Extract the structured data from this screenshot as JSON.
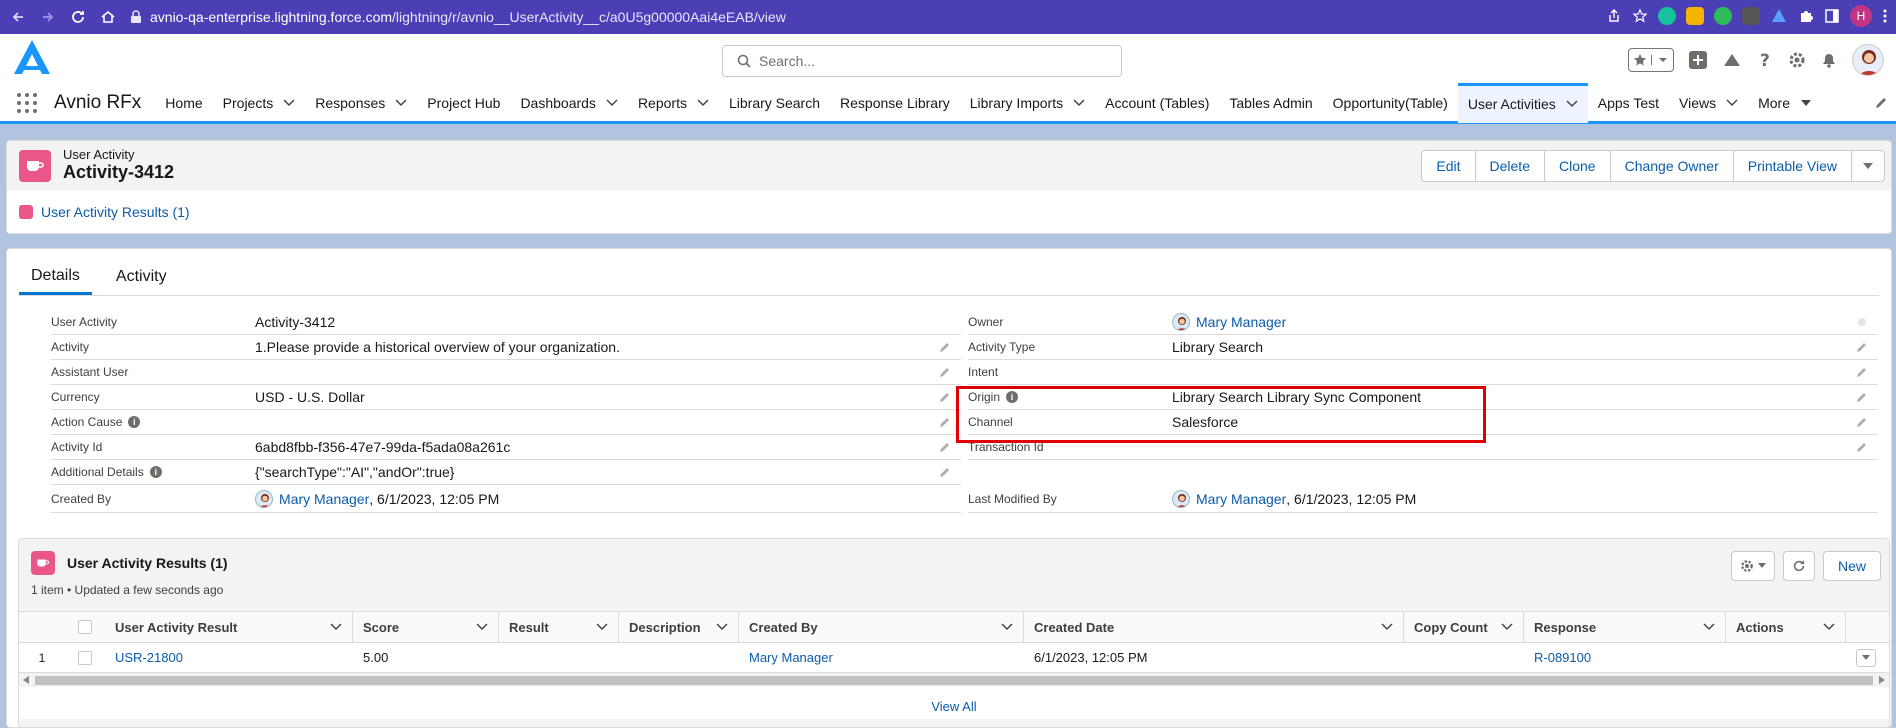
{
  "browser": {
    "url_host": "avnio-qa-enterprise.lightning.force.com",
    "url_path": "/lightning/r/avnio__UserActivity__c/a0U5g00000Aai4eEAB/view",
    "profile_initial": "H"
  },
  "header": {
    "search_placeholder": "Search..."
  },
  "nav": {
    "app_name": "Avnio RFx",
    "items": [
      {
        "label": "Home"
      },
      {
        "label": "Projects"
      },
      {
        "label": "Responses"
      },
      {
        "label": "Project Hub"
      },
      {
        "label": "Dashboards"
      },
      {
        "label": "Reports"
      },
      {
        "label": "Library Search"
      },
      {
        "label": "Response Library"
      },
      {
        "label": "Library Imports"
      },
      {
        "label": "Account (Tables)"
      },
      {
        "label": "Tables Admin"
      },
      {
        "label": "Opportunity(Table)"
      },
      {
        "label": "User Activities"
      },
      {
        "label": "Apps Test"
      },
      {
        "label": "Views"
      },
      {
        "label": "More"
      }
    ]
  },
  "record": {
    "object_type": "User Activity",
    "title": "Activity-3412",
    "buttons": [
      "Edit",
      "Delete",
      "Clone",
      "Change Owner",
      "Printable View"
    ],
    "related_link": "User Activity Results (1)"
  },
  "tabs": [
    "Details",
    "Activity"
  ],
  "details_left": [
    {
      "label": "User Activity",
      "value": "Activity-3412"
    },
    {
      "label": "Activity",
      "value": "1.Please provide a historical overview of your organization."
    },
    {
      "label": "Assistant User",
      "value": ""
    },
    {
      "label": "Currency",
      "value": "USD - U.S. Dollar"
    },
    {
      "label": "Action Cause",
      "value": ""
    },
    {
      "label": "Activity Id",
      "value": "6abd8fbb-f356-47e7-99da-f5ada08a261c"
    },
    {
      "label": "Additional Details",
      "value": "{\"searchType\":\"AI\",\"andOr\":true}"
    }
  ],
  "details_right": [
    {
      "label": "Owner",
      "value": "Mary Manager"
    },
    {
      "label": "Activity Type",
      "value": "Library Search"
    },
    {
      "label": "Intent",
      "value": ""
    },
    {
      "label": "Origin",
      "value": "Library Search Library Sync Component"
    },
    {
      "label": "Channel",
      "value": "Salesforce"
    },
    {
      "label": "Transaction Id",
      "value": ""
    }
  ],
  "created_by": {
    "label": "Created By",
    "user": "Mary Manager",
    "date": ", 6/1/2023, 12:05 PM"
  },
  "last_modified_by": {
    "label": "Last Modified By",
    "user": "Mary Manager",
    "date": ", 6/1/2023, 12:05 PM"
  },
  "related_list": {
    "title": "User Activity Results (1)",
    "subtitle": "1 item • Updated a few seconds ago",
    "new_label": "New",
    "columns": [
      "User Activity Result",
      "Score",
      "Result",
      "Description",
      "Created By",
      "Created Date",
      "Copy Count",
      "Response",
      "Actions"
    ],
    "rows": [
      {
        "num": "1",
        "result": "USR-21800",
        "score": "5.00",
        "res": "",
        "desc": "",
        "created_by": "Mary Manager",
        "created_date": "6/1/2023, 12:05 PM",
        "copy_count": "",
        "response": "R-089100"
      }
    ],
    "view_all": "View All"
  }
}
